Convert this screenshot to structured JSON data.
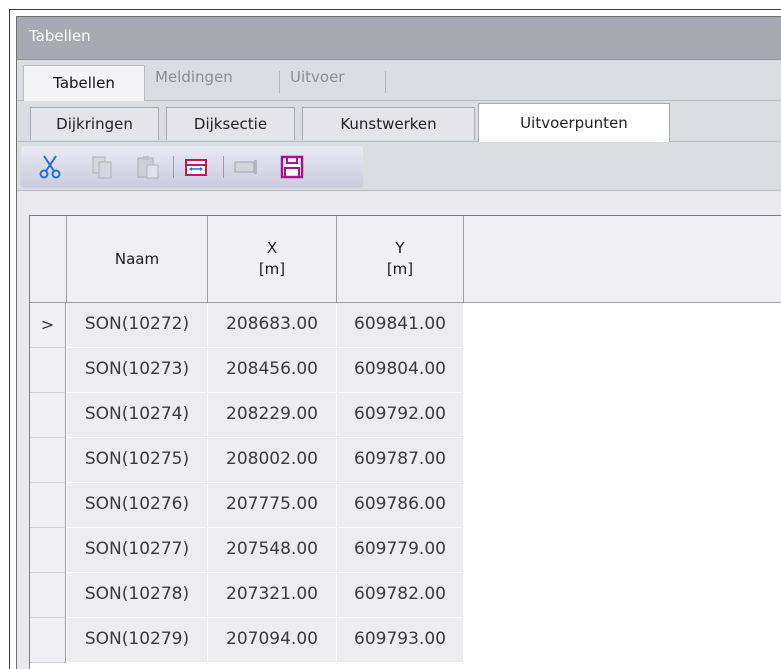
{
  "window": {
    "title": "Tabellen"
  },
  "main_tabs": [
    {
      "label": "Tabellen",
      "active": true
    },
    {
      "label": "Meldingen",
      "active": false
    },
    {
      "label": "Uitvoer",
      "active": false
    }
  ],
  "sub_tabs": [
    {
      "label": "Dijkringen",
      "active": false
    },
    {
      "label": "Dijksectie",
      "active": false
    },
    {
      "label": "Kunstwerken",
      "active": false
    },
    {
      "label": "Uitvoerpunten",
      "active": true
    }
  ],
  "toolbar": {
    "icons": [
      "cut-icon",
      "copy-icon",
      "paste-icon",
      "column-width-icon",
      "edit-row-icon",
      "save-icon"
    ],
    "accent": "#1f6fd6",
    "save_color": "#b0128c"
  },
  "table": {
    "columns": [
      {
        "label": "Naam"
      },
      {
        "label": "X\n[m]"
      },
      {
        "label": "Y\n[m]"
      }
    ],
    "current_row_marker": ">",
    "rows": [
      [
        "SON(10272)",
        "208683.00",
        "609841.00"
      ],
      [
        "SON(10273)",
        "208456.00",
        "609804.00"
      ],
      [
        "SON(10274)",
        "208229.00",
        "609792.00"
      ],
      [
        "SON(10275)",
        "208002.00",
        "609787.00"
      ],
      [
        "SON(10276)",
        "207775.00",
        "609786.00"
      ],
      [
        "SON(10277)",
        "207548.00",
        "609779.00"
      ],
      [
        "SON(10278)",
        "207321.00",
        "609782.00"
      ],
      [
        "SON(10279)",
        "207094.00",
        "609793.00"
      ]
    ]
  }
}
